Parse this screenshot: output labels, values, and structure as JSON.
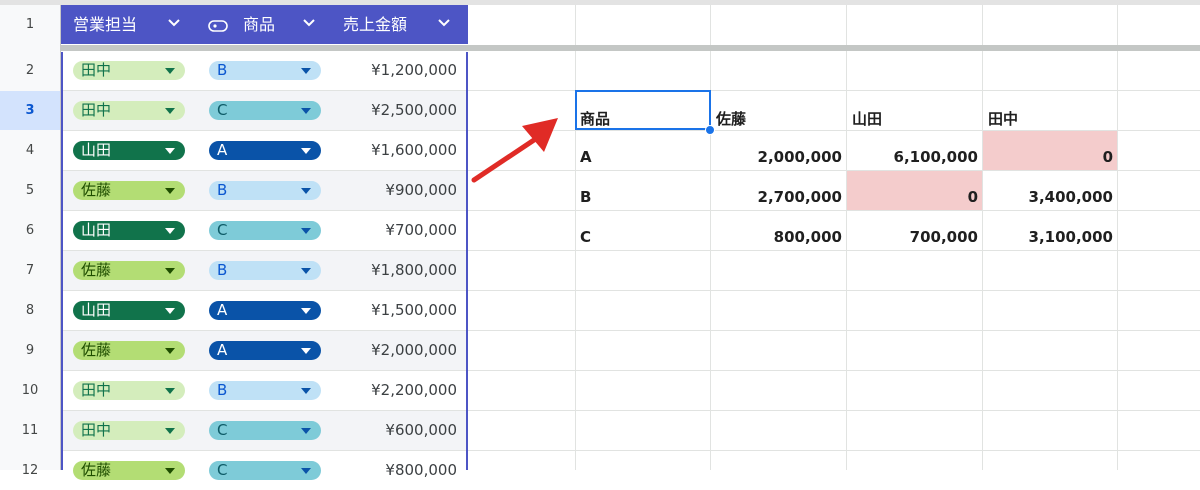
{
  "colors": {
    "table_header_bg": "#4d55c5",
    "tanaka_chip": "#d4edbc",
    "yamada_chip": "#11734b",
    "sato_chip": "#b3dd74",
    "product_b_chip": "#bfe1f6",
    "product_c_chip": "#7ecbd8",
    "product_a_chip": "#0a53a8",
    "zero_highlight": "#f4cccc",
    "selection": "#1a73e8",
    "arrow": "#e02b26"
  },
  "row_numbers": [
    "1",
    "2",
    "3",
    "4",
    "5",
    "6",
    "7",
    "8",
    "9",
    "10",
    "11",
    "12"
  ],
  "table": {
    "headers": {
      "rep": "営業担当",
      "product": "商品",
      "amount": "売上金額"
    },
    "rows": [
      {
        "rep": "田中",
        "product": "B",
        "amount": "¥1,200,000"
      },
      {
        "rep": "田中",
        "product": "C",
        "amount": "¥2,500,000"
      },
      {
        "rep": "山田",
        "product": "A",
        "amount": "¥1,600,000"
      },
      {
        "rep": "佐藤",
        "product": "B",
        "amount": "¥900,000"
      },
      {
        "rep": "山田",
        "product": "C",
        "amount": "¥700,000"
      },
      {
        "rep": "佐藤",
        "product": "B",
        "amount": "¥1,800,000"
      },
      {
        "rep": "山田",
        "product": "A",
        "amount": "¥1,500,000"
      },
      {
        "rep": "佐藤",
        "product": "A",
        "amount": "¥2,000,000"
      },
      {
        "rep": "田中",
        "product": "B",
        "amount": "¥2,200,000"
      },
      {
        "rep": "田中",
        "product": "C",
        "amount": "¥600,000"
      },
      {
        "rep": "佐藤",
        "product": "C",
        "amount": "¥800,000"
      }
    ]
  },
  "pivot": {
    "header": [
      "商品",
      "佐藤",
      "山田",
      "田中"
    ],
    "rows": [
      {
        "label": "A",
        "values": [
          "2,000,000",
          "6,100,000",
          "0"
        ]
      },
      {
        "label": "B",
        "values": [
          "2,700,000",
          "0",
          "3,400,000"
        ]
      },
      {
        "label": "C",
        "values": [
          "800,000",
          "700,000",
          "3,100,000"
        ]
      }
    ]
  }
}
